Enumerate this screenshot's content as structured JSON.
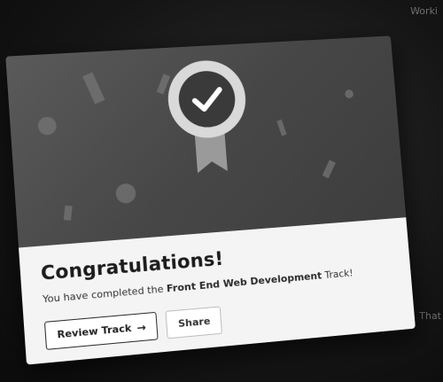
{
  "background": {
    "top_right_text": "Worki",
    "bottom_right_text": "That"
  },
  "modal": {
    "title": "Congratulations!",
    "message_prefix": "You have completed the ",
    "track_name": "Front End Web Development",
    "message_suffix": " Track!",
    "badge_icon": "award-ribbon-check-icon",
    "colors": {
      "hero": "#4a4a4a",
      "content": "#f4f4f4",
      "text": "#1c1c1c"
    }
  },
  "actions": {
    "review_label": "Review Track",
    "review_icon": "arrow-right-icon",
    "review_arrow": "→",
    "share_label": "Share"
  }
}
